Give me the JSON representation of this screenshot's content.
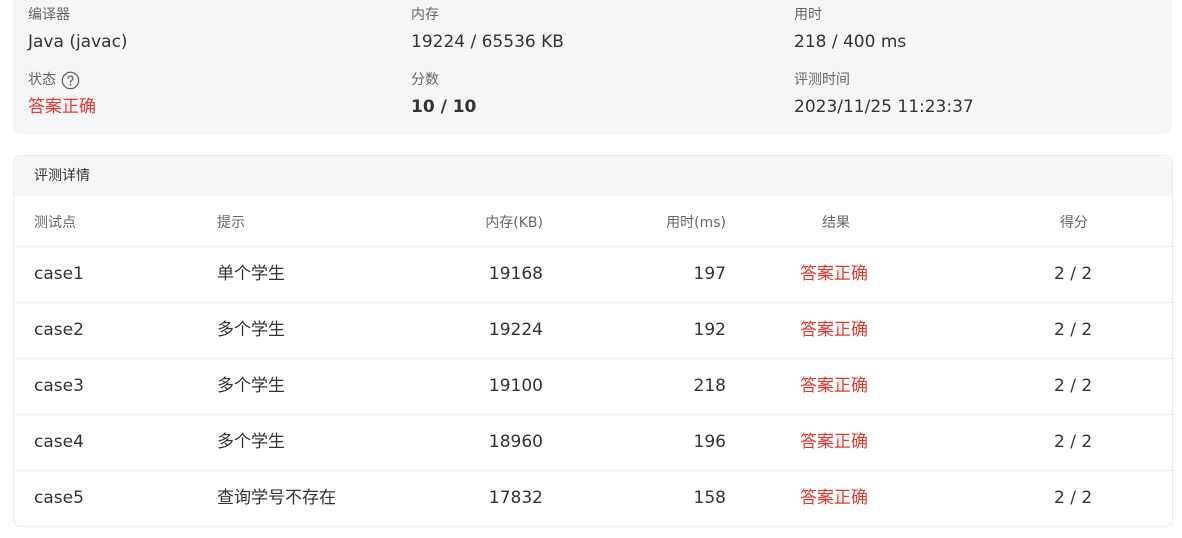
{
  "summary": {
    "compiler": {
      "label": "编译器",
      "value": "Java (javac)"
    },
    "memory": {
      "label": "内存",
      "value": "19224 / 65536 KB"
    },
    "time": {
      "label": "用时",
      "value": "218 / 400 ms"
    },
    "status": {
      "label": "状态",
      "value": "答案正确",
      "icon": "help-circle-icon"
    },
    "score": {
      "label": "分数",
      "value": "10 / 10"
    },
    "judge_time": {
      "label": "评测时间",
      "value": "2023/11/25 11:23:37"
    }
  },
  "detail": {
    "title": "评测详情",
    "headers": [
      "测试点",
      "提示",
      "内存(KB)",
      "用时(ms)",
      "结果",
      "得分"
    ],
    "rows": [
      {
        "case": "case1",
        "hint": "单个学生",
        "memory": "19168",
        "time": "197",
        "result": "答案正确",
        "score": "2 / 2"
      },
      {
        "case": "case2",
        "hint": "多个学生",
        "memory": "19224",
        "time": "192",
        "result": "答案正确",
        "score": "2 / 2"
      },
      {
        "case": "case3",
        "hint": "多个学生",
        "memory": "19100",
        "time": "218",
        "result": "答案正确",
        "score": "2 / 2"
      },
      {
        "case": "case4",
        "hint": "多个学生",
        "memory": "18960",
        "time": "196",
        "result": "答案正确",
        "score": "2 / 2"
      },
      {
        "case": "case5",
        "hint": "查询学号不存在",
        "memory": "17832",
        "time": "158",
        "result": "答案正确",
        "score": "2 / 2"
      }
    ]
  },
  "colors": {
    "accepted": "#e8382e",
    "panel_bg": "#f5f6f8"
  }
}
